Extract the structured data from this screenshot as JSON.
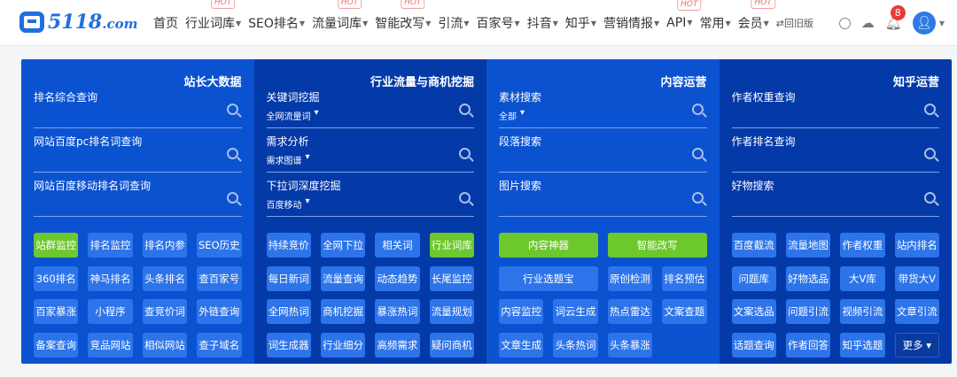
{
  "header": {
    "logo": "5118",
    "logo_suffix": ".com",
    "nav": [
      {
        "label": "首页",
        "caret": false,
        "hot": false
      },
      {
        "label": "行业词库",
        "caret": true,
        "hot": true
      },
      {
        "label": "SEO排名",
        "caret": true,
        "hot": false
      },
      {
        "label": "流量词库",
        "caret": true,
        "hot": true
      },
      {
        "label": "智能改写",
        "caret": true,
        "hot": true
      },
      {
        "label": "引流",
        "caret": true,
        "hot": false
      },
      {
        "label": "百家号",
        "caret": true,
        "hot": false
      },
      {
        "label": "抖音",
        "caret": true,
        "hot": false
      },
      {
        "label": "知乎",
        "caret": true,
        "hot": false
      },
      {
        "label": "营销情报",
        "caret": true,
        "hot": false
      },
      {
        "label": "API",
        "caret": true,
        "hot": true
      },
      {
        "label": "常用",
        "caret": true,
        "hot": false
      },
      {
        "label": "会员",
        "caret": true,
        "hot": true
      }
    ],
    "hot_label": "HOT",
    "old_version": "⇄回旧版",
    "notification_count": "8"
  },
  "columns": [
    {
      "title": "站长大数据",
      "theme": "light",
      "fields": [
        {
          "label": "排名综合查询",
          "sub": ""
        },
        {
          "label": "网站百度pc排名词查询",
          "sub": ""
        },
        {
          "label": "网站百度移动排名词查询",
          "sub": ""
        }
      ],
      "buttons": [
        {
          "label": "站群监控",
          "green": true
        },
        {
          "label": "排名监控"
        },
        {
          "label": "排名内参"
        },
        {
          "label": "SEO历史"
        },
        {
          "label": "360排名"
        },
        {
          "label": "神马排名"
        },
        {
          "label": "头条排名"
        },
        {
          "label": "查百家号"
        },
        {
          "label": "百家暴涨"
        },
        {
          "label": "小程序"
        },
        {
          "label": "查竞价词"
        },
        {
          "label": "外链查询"
        },
        {
          "label": "备案查询"
        },
        {
          "label": "竞品网站"
        },
        {
          "label": "相似网站"
        },
        {
          "label": "查子域名"
        }
      ]
    },
    {
      "title": "行业流量与商机挖掘",
      "theme": "dark",
      "fields": [
        {
          "label": "关键词挖掘",
          "sub": "全网流量词"
        },
        {
          "label": "需求分析",
          "sub": "需求图谱"
        },
        {
          "label": "下拉词深度挖掘",
          "sub": "百度移动"
        }
      ],
      "buttons": [
        {
          "label": "持续竞价"
        },
        {
          "label": "全网下拉"
        },
        {
          "label": "相关词"
        },
        {
          "label": "行业词库",
          "green": true
        },
        {
          "label": "每日新词"
        },
        {
          "label": "流量查询"
        },
        {
          "label": "动态趋势"
        },
        {
          "label": "长尾监控"
        },
        {
          "label": "全网热词"
        },
        {
          "label": "商机挖掘"
        },
        {
          "label": "暴涨热词"
        },
        {
          "label": "流量规划"
        },
        {
          "label": "词生成器"
        },
        {
          "label": "行业细分"
        },
        {
          "label": "高频需求"
        },
        {
          "label": "疑问商机"
        }
      ]
    },
    {
      "title": "内容运营",
      "theme": "light",
      "fields": [
        {
          "label": "素材搜索",
          "sub": "全部"
        },
        {
          "label": "段落搜索",
          "sub": ""
        },
        {
          "label": "图片搜索",
          "sub": ""
        }
      ],
      "buttons": [
        {
          "label": "内容神器",
          "green": true,
          "span": true
        },
        {
          "label": "智能改写",
          "green": true,
          "span": true
        },
        {
          "label": "行业选题宝",
          "span": true
        },
        {
          "label": "原创检测"
        },
        {
          "label": "排名预估"
        },
        {
          "label": "内容监控"
        },
        {
          "label": "词云生成"
        },
        {
          "label": "热点雷达"
        },
        {
          "label": "文案查题"
        },
        {
          "label": "文章生成"
        },
        {
          "label": "头条热词"
        },
        {
          "label": "头条暴涨"
        }
      ]
    },
    {
      "title": "知乎运营",
      "theme": "dark",
      "fields": [
        {
          "label": "作者权重查询",
          "sub": ""
        },
        {
          "label": "作者排名查询",
          "sub": ""
        },
        {
          "label": "好物搜索",
          "sub": ""
        }
      ],
      "buttons": [
        {
          "label": "百度截流"
        },
        {
          "label": "流量地图"
        },
        {
          "label": "作者权重"
        },
        {
          "label": "站内排名"
        },
        {
          "label": "问题库"
        },
        {
          "label": "好物选品"
        },
        {
          "label": "大V库"
        },
        {
          "label": "带货大V"
        },
        {
          "label": "文案选品"
        },
        {
          "label": "问题引流"
        },
        {
          "label": "视频引流"
        },
        {
          "label": "文章引流"
        },
        {
          "label": "话题查询"
        },
        {
          "label": "作者回答"
        },
        {
          "label": "知乎选题"
        },
        {
          "label": "更多 ▾",
          "more": true
        }
      ]
    }
  ]
}
